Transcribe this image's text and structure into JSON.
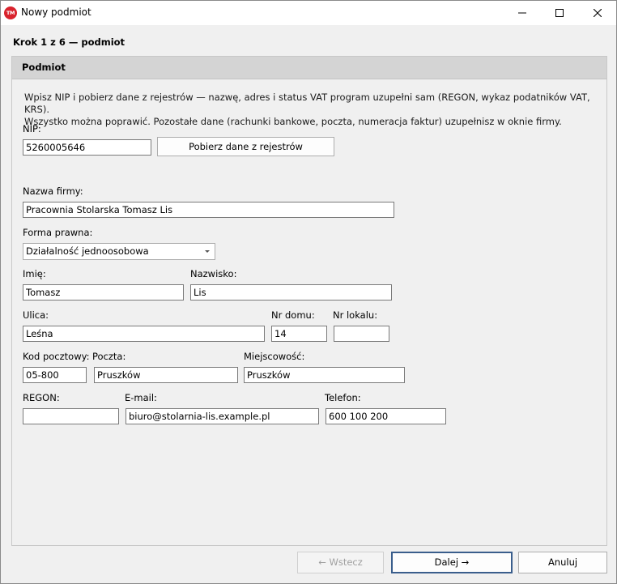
{
  "window": {
    "icon_text": "TM",
    "title": "Nowy podmiot"
  },
  "step": {
    "title": "Krok 1 z 6 — podmiot"
  },
  "panel": {
    "header": "Podmiot",
    "info_line1": "Wpisz NIP i pobierz dane z rejestrów — nazwę, adres i status VAT program uzupełni sam (REGON, wykaz podatników VAT, KRS).",
    "info_line2": "Wszystko można poprawić. Pozostałe dane (rachunki bankowe, poczta, numeracja faktur) uzupełnisz w oknie firmy."
  },
  "form": {
    "nip_label": "NIP:",
    "nip_value": "5260005646",
    "fetch_button": "Pobierz dane z rejestrów",
    "company_label": "Nazwa firmy:",
    "company_value": "Pracownia Stolarska Tomasz Lis",
    "legal_form_label": "Forma prawna:",
    "legal_form_value": "Działalność jednoosobowa",
    "first_name_label": "Imię:",
    "first_name_value": "Tomasz",
    "last_name_label": "Nazwisko:",
    "last_name_value": "Lis",
    "street_label": "Ulica:",
    "street_value": "Leśna",
    "house_no_label": "Nr domu:",
    "house_no_value": "14",
    "apt_no_label": "Nr lokalu:",
    "apt_no_value": "",
    "postal_code_label": "Kod pocztowy:",
    "postal_code_value": "05-800",
    "post_office_label": "Poczta:",
    "post_office_value": "Pruszków",
    "city_label": "Miejscowość:",
    "city_value": "Pruszków",
    "regon_label": "REGON:",
    "regon_value": "",
    "email_label": "E-mail:",
    "email_value": "biuro@stolarnia-lis.example.pl",
    "phone_label": "Telefon:",
    "phone_value": "600 100 200"
  },
  "footer": {
    "back_button": "← Wstecz",
    "next_button": "Dalej →",
    "cancel_button": "Anuluj"
  },
  "icons": {
    "app": "tm-logo-icon",
    "minimize": "minimize-icon",
    "maximize": "maximize-icon",
    "close": "close-icon",
    "dropdown": "chevron-down-icon"
  },
  "colors": {
    "app_icon": "#d9232d",
    "panel_header": "#d4d4d4",
    "primary_button_border": "#3a5e8c"
  }
}
